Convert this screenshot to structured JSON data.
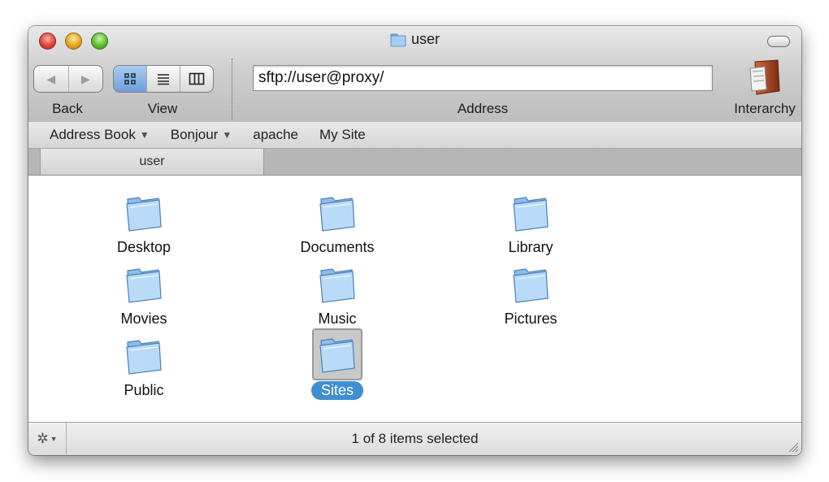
{
  "window": {
    "title": "user"
  },
  "toolbar": {
    "back_label": "Back",
    "view_label": "View",
    "address_label": "Address",
    "address_value": "sftp://user@proxy/",
    "app_label": "Interarchy"
  },
  "bookmarks": [
    {
      "label": "Address Book",
      "dropdown": true
    },
    {
      "label": "Bonjour",
      "dropdown": true
    },
    {
      "label": "apache",
      "dropdown": false
    },
    {
      "label": "My Site",
      "dropdown": false
    }
  ],
  "tabs": [
    {
      "label": "user"
    }
  ],
  "items": [
    {
      "name": "Desktop",
      "icon": "folder-icon",
      "selected": false
    },
    {
      "name": "Documents",
      "icon": "folder-icon",
      "selected": false
    },
    {
      "name": "Library",
      "icon": "folder-icon",
      "selected": false
    },
    {
      "name": "Movies",
      "icon": "folder-icon",
      "selected": false
    },
    {
      "name": "Music",
      "icon": "folder-icon",
      "selected": false
    },
    {
      "name": "Pictures",
      "icon": "folder-icon",
      "selected": false
    },
    {
      "name": "Public",
      "icon": "folder-icon",
      "selected": false
    },
    {
      "name": "Sites",
      "icon": "folder-icon",
      "selected": true
    }
  ],
  "status": {
    "text": "1 of 8 items selected"
  },
  "colors": {
    "selection": "#3f8ecf",
    "view_active": "#6f9fd6"
  }
}
